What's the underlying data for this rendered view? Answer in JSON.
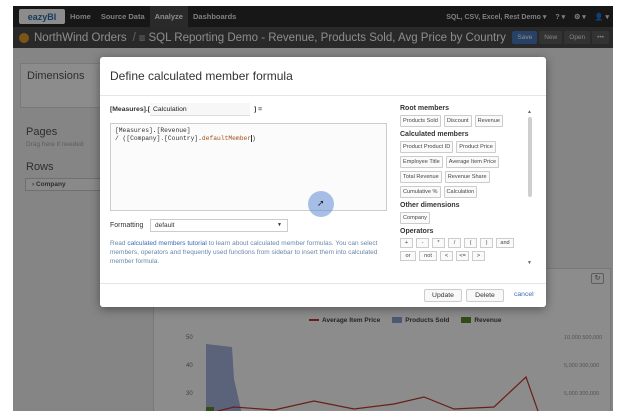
{
  "nav": {
    "logo": "eazyBI",
    "items": [
      "Home",
      "Source Data",
      "Analyze",
      "Dashboards"
    ],
    "active": "Analyze",
    "right": [
      "SQL, CSV, Excel, Rest Demo ▾",
      "? ▾",
      "⚙ ▾",
      "👤 ▾"
    ]
  },
  "titlebar": {
    "org": "NorthWind Orders",
    "sep": "/",
    "report": "SQL Reporting Demo - Revenue, Products Sold, Avg Price by Country",
    "buttons": [
      "Save",
      "New",
      "Open",
      "•••"
    ]
  },
  "background": {
    "dimensions": "Dimensions",
    "pages": "Pages",
    "pages_hint": "Drag here if needed",
    "rows": "Rows",
    "row_company": "› Company",
    "legend": [
      "Average Item Price",
      "Products Sold",
      "Revenue"
    ],
    "legend_colors": [
      "#c0392b",
      "#8ea1d4",
      "#5b8a2b"
    ],
    "left_ticks": [
      "50",
      "40",
      "30"
    ],
    "right_ticks": [
      "10,000   500,000",
      "5,000   300,000",
      "5,000   300,000"
    ],
    "refresh_icon": "↻"
  },
  "modal": {
    "title": "Define calculated member formula",
    "measures_prefix": "[Measures].[",
    "calc_name": "Calculation",
    "bracket_eq": "] =",
    "formula_line1": "[Measures].[Revenue]",
    "formula_line2_prefix": "/ ([Company].[Country].",
    "formula_line2_kw": "defaultMember",
    "formula_line2_suffix": ")",
    "formatting_label": "Formatting",
    "formatting_value": "default",
    "help_before": "Read ",
    "help_link": "calculated members tutorial",
    "help_after": " to learn about calculated member formulas. You can select members, operators and frequently used functions from sidebar to insert them into calculated member formula.",
    "sidebar": {
      "root_head": "Root members",
      "root": [
        "Products Sold",
        "Discount",
        "Revenue"
      ],
      "calc_head": "Calculated members",
      "calc": [
        "Product Product ID",
        "Product Price",
        "Employee Title",
        "Average Item Price",
        "Total Revenue",
        "Revenue Share",
        "Cumulative %",
        "Calculation"
      ],
      "other_head": "Other dimensions",
      "other": [
        "Company"
      ],
      "ops_head": "Operators",
      "ops": [
        "+",
        "-",
        "*",
        "/",
        "(",
        ")",
        "and",
        "or",
        "not",
        "<",
        "<=",
        ">"
      ]
    },
    "buttons": {
      "update": "Update",
      "delete": "Delete",
      "cancel": "cancel"
    }
  }
}
